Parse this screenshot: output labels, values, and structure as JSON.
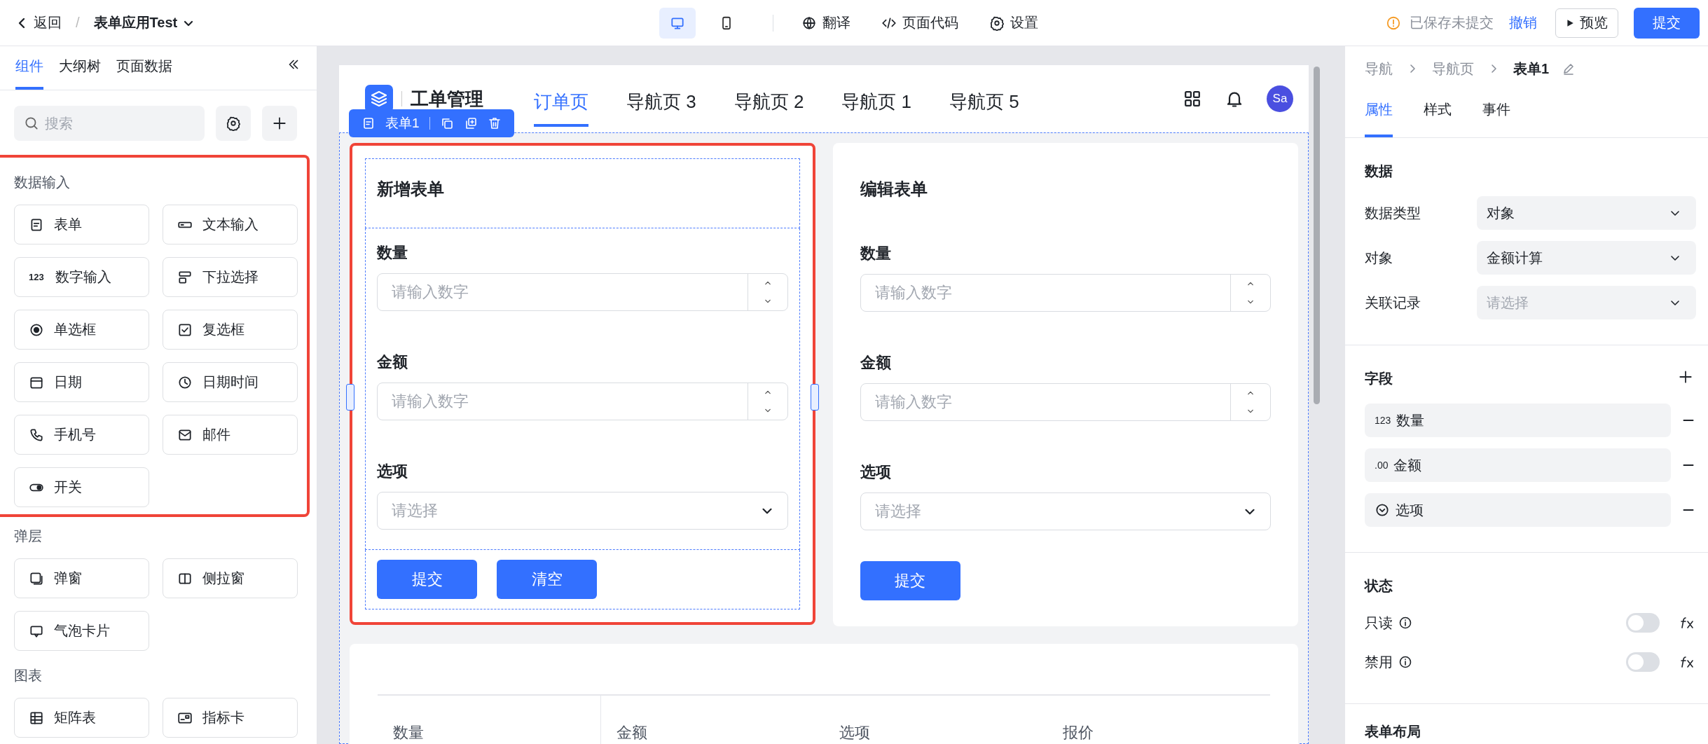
{
  "topbar": {
    "back": "返回",
    "app_title": "表单应用Test",
    "devices": [
      {
        "kind": "desktop",
        "selected": true
      },
      {
        "kind": "mobile",
        "selected": false
      }
    ],
    "tools": [
      {
        "kind": "translate",
        "label": "翻译"
      },
      {
        "kind": "code",
        "label": "页面代码"
      },
      {
        "kind": "settings",
        "label": "设置"
      }
    ],
    "separator": "/",
    "save_status": "已保存未提交",
    "undo": "撤销",
    "preview": "预览",
    "submit": "提交"
  },
  "left_panel": {
    "tabs": [
      {
        "label": "组件",
        "selected": true
      },
      {
        "label": "大纲树",
        "selected": false
      },
      {
        "label": "页面数据",
        "selected": false
      }
    ],
    "search": {
      "placeholder": "搜索"
    },
    "groups": [
      {
        "title": "数据输入",
        "highlighted": true,
        "items": [
          {
            "kind": "form",
            "label": "表单"
          },
          {
            "kind": "text",
            "label": "文本输入"
          },
          {
            "kind": "number",
            "badge": "123",
            "label": "数字输入"
          },
          {
            "kind": "select",
            "label": "下拉选择"
          },
          {
            "kind": "radio",
            "label": "单选框"
          },
          {
            "kind": "checkbox",
            "label": "复选框"
          },
          {
            "kind": "date",
            "label": "日期"
          },
          {
            "kind": "datetime",
            "label": "日期时间"
          },
          {
            "kind": "phone",
            "label": "手机号"
          },
          {
            "kind": "email",
            "label": "邮件"
          },
          {
            "kind": "switch",
            "label": "开关"
          }
        ]
      },
      {
        "title": "弹层",
        "highlighted": false,
        "items": [
          {
            "kind": "dialog",
            "label": "弹窗"
          },
          {
            "kind": "drawer",
            "label": "侧拉窗"
          },
          {
            "kind": "popover",
            "label": "气泡卡片"
          }
        ]
      },
      {
        "title": "图表",
        "highlighted": false,
        "items": [
          {
            "kind": "matrix",
            "label": "矩阵表"
          },
          {
            "kind": "metric",
            "label": "指标卡"
          }
        ]
      }
    ]
  },
  "canvas": {
    "app_title": "工单管理",
    "nav": [
      {
        "label": "订单页",
        "selected": true
      },
      {
        "label": "导航页 3",
        "selected": false
      },
      {
        "label": "导航页 2",
        "selected": false
      },
      {
        "label": "导航页 1",
        "selected": false
      },
      {
        "label": "导航页 5",
        "selected": false
      }
    ],
    "avatar": "Sa",
    "selection_tag": "表单1",
    "forms": [
      {
        "title": "新增表单",
        "selected": true,
        "highlighted": true,
        "fields": [
          {
            "label": "数量",
            "kind": "number",
            "placeholder": "请输入数字"
          },
          {
            "label": "金额",
            "kind": "number",
            "placeholder": "请输入数字"
          },
          {
            "label": "选项",
            "kind": "select",
            "placeholder": "请选择"
          }
        ],
        "buttons": [
          "提交",
          "清空"
        ]
      },
      {
        "title": "编辑表单",
        "selected": false,
        "highlighted": false,
        "fields": [
          {
            "label": "数量",
            "kind": "number",
            "placeholder": "请输入数字"
          },
          {
            "label": "金额",
            "kind": "number",
            "placeholder": "请输入数字"
          },
          {
            "label": "选项",
            "kind": "select",
            "placeholder": "请选择"
          }
        ],
        "buttons": [
          "提交"
        ]
      }
    ],
    "table": {
      "columns": [
        "数量",
        "金额",
        "选项",
        "报价"
      ]
    }
  },
  "right_panel": {
    "breadcrumb": [
      {
        "label": "导航",
        "current": false
      },
      {
        "label": "导航页",
        "current": false
      },
      {
        "label": "表单1",
        "current": true
      }
    ],
    "tabs": [
      {
        "label": "属性",
        "selected": true
      },
      {
        "label": "样式",
        "selected": false
      },
      {
        "label": "事件",
        "selected": false
      }
    ],
    "data_section": {
      "title": "数据",
      "rows": [
        {
          "label": "数据类型",
          "value": "对象"
        },
        {
          "label": "对象",
          "value": "金额计算"
        },
        {
          "label": "关联记录",
          "placeholder": "请选择"
        }
      ]
    },
    "fields_section": {
      "title": "字段",
      "fields": [
        {
          "kind": "number",
          "prefix": "123",
          "label": "数量"
        },
        {
          "kind": "decimal",
          "prefix": ".00",
          "label": "金额"
        },
        {
          "kind": "select",
          "label": "选项"
        }
      ]
    },
    "state_section": {
      "title": "状态",
      "toggles": [
        {
          "label": "只读",
          "on": false
        },
        {
          "label": "禁用",
          "on": false
        }
      ]
    },
    "layout_section": {
      "title": "表单布局"
    }
  }
}
